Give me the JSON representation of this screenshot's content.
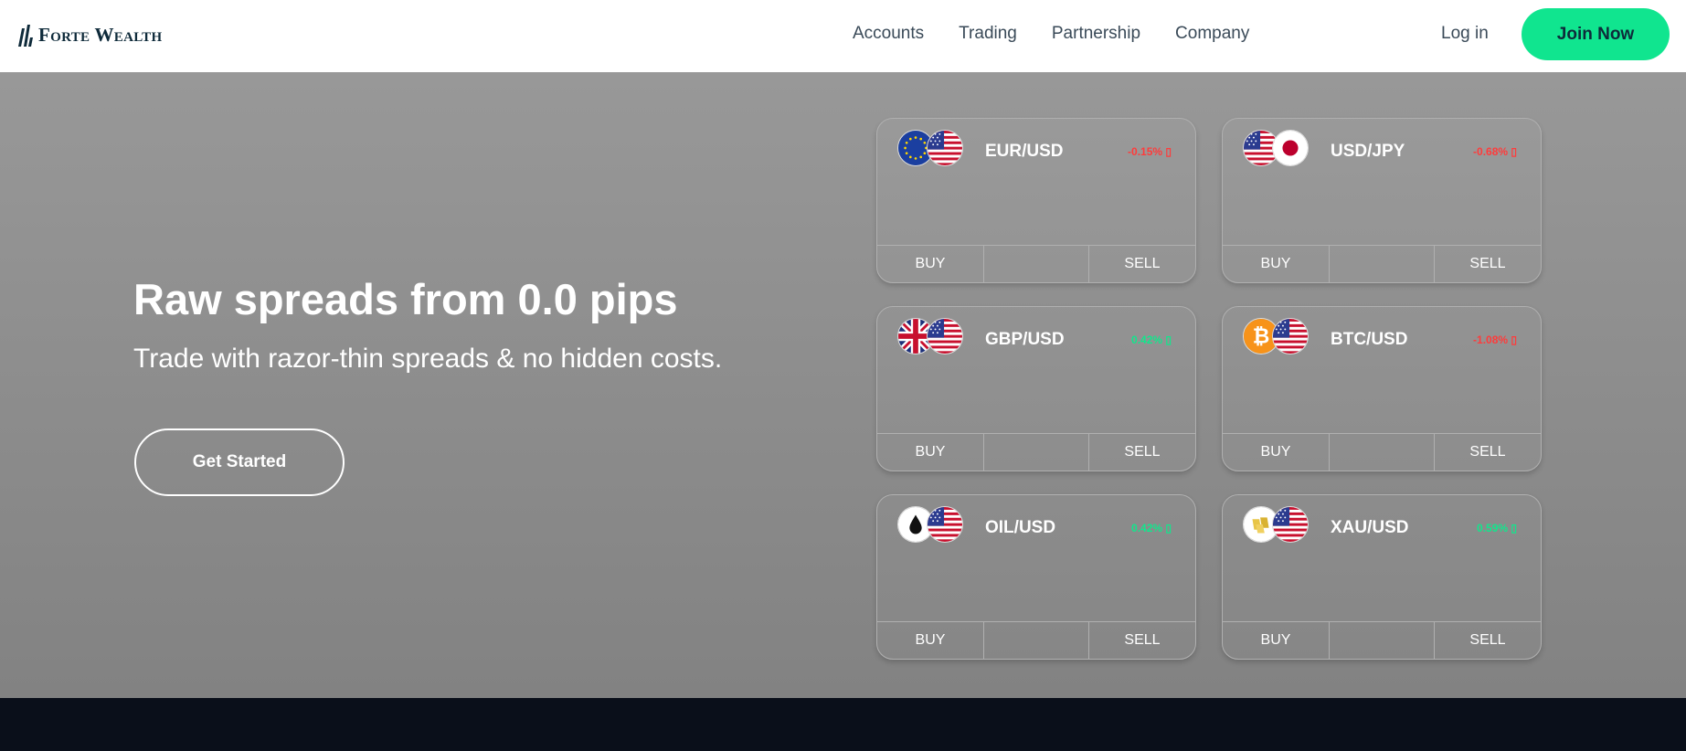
{
  "header": {
    "brand": "Forte Wealth",
    "nav": [
      "Accounts",
      "Trading",
      "Partnership",
      "Company"
    ],
    "login": "Log in",
    "join": "Join Now"
  },
  "hero": {
    "title": "Raw spreads from 0.0 pips",
    "subtitle": "Trade with razor-thin spreads & no hidden costs.",
    "cta": "Get Started"
  },
  "cards": [
    {
      "pair": "EUR/USD",
      "change": "-0.15% ▯",
      "direction": "down",
      "buy": "BUY",
      "sell": "SELL",
      "flags": [
        "eu-flag-icon",
        "us-flag-icon"
      ]
    },
    {
      "pair": "USD/JPY",
      "change": "-0.68% ▯",
      "direction": "down",
      "buy": "BUY",
      "sell": "SELL",
      "flags": [
        "us-flag-icon",
        "jp-flag-icon"
      ]
    },
    {
      "pair": "GBP/USD",
      "change": "0.42% ▯",
      "direction": "up",
      "buy": "BUY",
      "sell": "SELL",
      "flags": [
        "uk-flag-icon",
        "us-flag-icon"
      ]
    },
    {
      "pair": "BTC/USD",
      "change": "-1.08% ▯",
      "direction": "down",
      "buy": "BUY",
      "sell": "SELL",
      "flags": [
        "bitcoin-icon",
        "us-flag-icon"
      ]
    },
    {
      "pair": "OIL/USD",
      "change": "0.42% ▯",
      "direction": "up",
      "buy": "BUY",
      "sell": "SELL",
      "flags": [
        "oil-drop-icon",
        "us-flag-icon"
      ]
    },
    {
      "pair": "XAU/USD",
      "change": "0.59% ▯",
      "direction": "up",
      "buy": "BUY",
      "sell": "SELL",
      "flags": [
        "gold-bars-icon",
        "us-flag-icon"
      ]
    }
  ],
  "colors": {
    "accent": "#10e58f",
    "negative": "#ff3b3b",
    "positive": "#12e68c",
    "brand": "#0e2a3a"
  }
}
